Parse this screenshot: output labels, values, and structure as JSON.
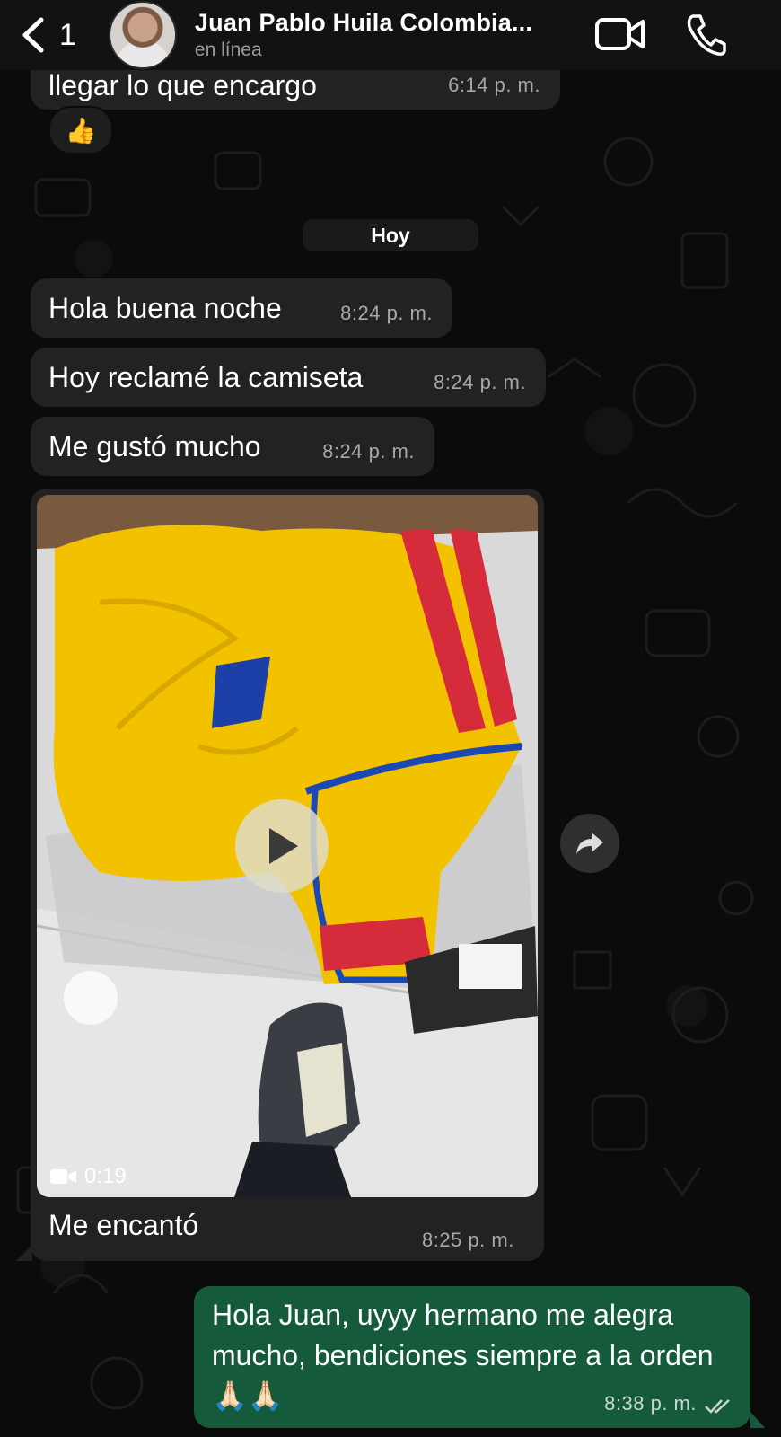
{
  "header": {
    "back_count": "1",
    "contact_name": "Juan Pablo Huila Colombia...",
    "status": "en línea"
  },
  "messages": [
    {
      "text": "llegar lo que encargo",
      "time": "6:14 p. m.",
      "direction": "in"
    },
    {
      "reaction": "👍"
    },
    {
      "day": "Hoy"
    },
    {
      "text": "Hola buena noche",
      "time": "8:24 p. m.",
      "direction": "in"
    },
    {
      "text": "Hoy reclamé la camiseta",
      "time": "8:24 p. m.",
      "direction": "in"
    },
    {
      "text": "Me gustó mucho",
      "time": "8:24 p. m.",
      "direction": "in"
    },
    {
      "video_duration": "0:19",
      "caption": "Me encantó",
      "time": "8:25 p. m.",
      "direction": "in"
    },
    {
      "text": "Hola Juan, uyyy hermano me alegra mucho, bendiciones siempre a la orden 🙏🏻🙏🏻",
      "time": "8:38 p. m.",
      "direction": "out",
      "read": true
    }
  ],
  "colors": {
    "incoming_bubble": "#222222",
    "outgoing_bubble": "#155a3a",
    "background": "#0b0b0b"
  }
}
